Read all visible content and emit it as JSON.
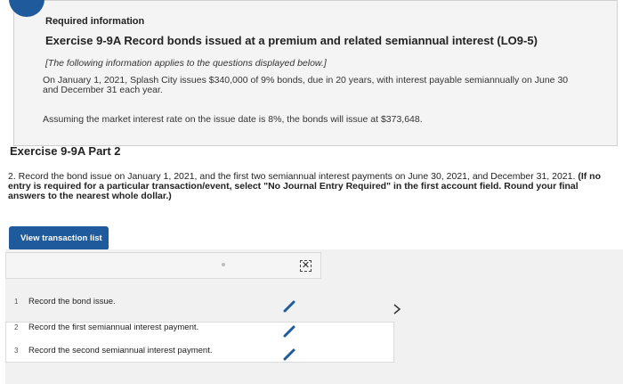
{
  "info": {
    "title": "Required information",
    "exercise": "Exercise 9-9A Record bonds issued at a premium and related semiannual interest (LO9-5)",
    "note": "[The following information applies to the questions displayed below.]",
    "paragraph": "On January 1, 2021, Splash City issues $340,000 of 9% bonds, due in 20 years, with interest payable semiannually on June 30 and December 31 each year.",
    "assumption": "Assuming the market interest rate on the issue date is 8%, the bonds will issue at $373,648."
  },
  "part": {
    "title": "Exercise 9-9A Part 2"
  },
  "instruction": {
    "text": "2. Record the bond issue on January 1, 2021, and the first two semiannual interest payments on June 30, 2021, and December 31, 2021. ",
    "bold": "(If no entry is required for a particular transaction/event, select \"No Journal Entry Required\" in the first account field. Round your final answers to the nearest whole dollar.)"
  },
  "transactions": {
    "button_label": "View transaction list",
    "items": [
      {
        "num": "1",
        "label": "Record the bond issue."
      },
      {
        "num": "2",
        "label": "Record the first semiannual interest payment."
      },
      {
        "num": "3",
        "label": "Record the second semiannual interest payment."
      }
    ]
  },
  "icons": {
    "pencil": "pencil-icon",
    "close": "close-icon",
    "next": "chevron-right-icon"
  },
  "colors": {
    "accent": "#1f5b9c",
    "panel": "#f1f1f1"
  }
}
